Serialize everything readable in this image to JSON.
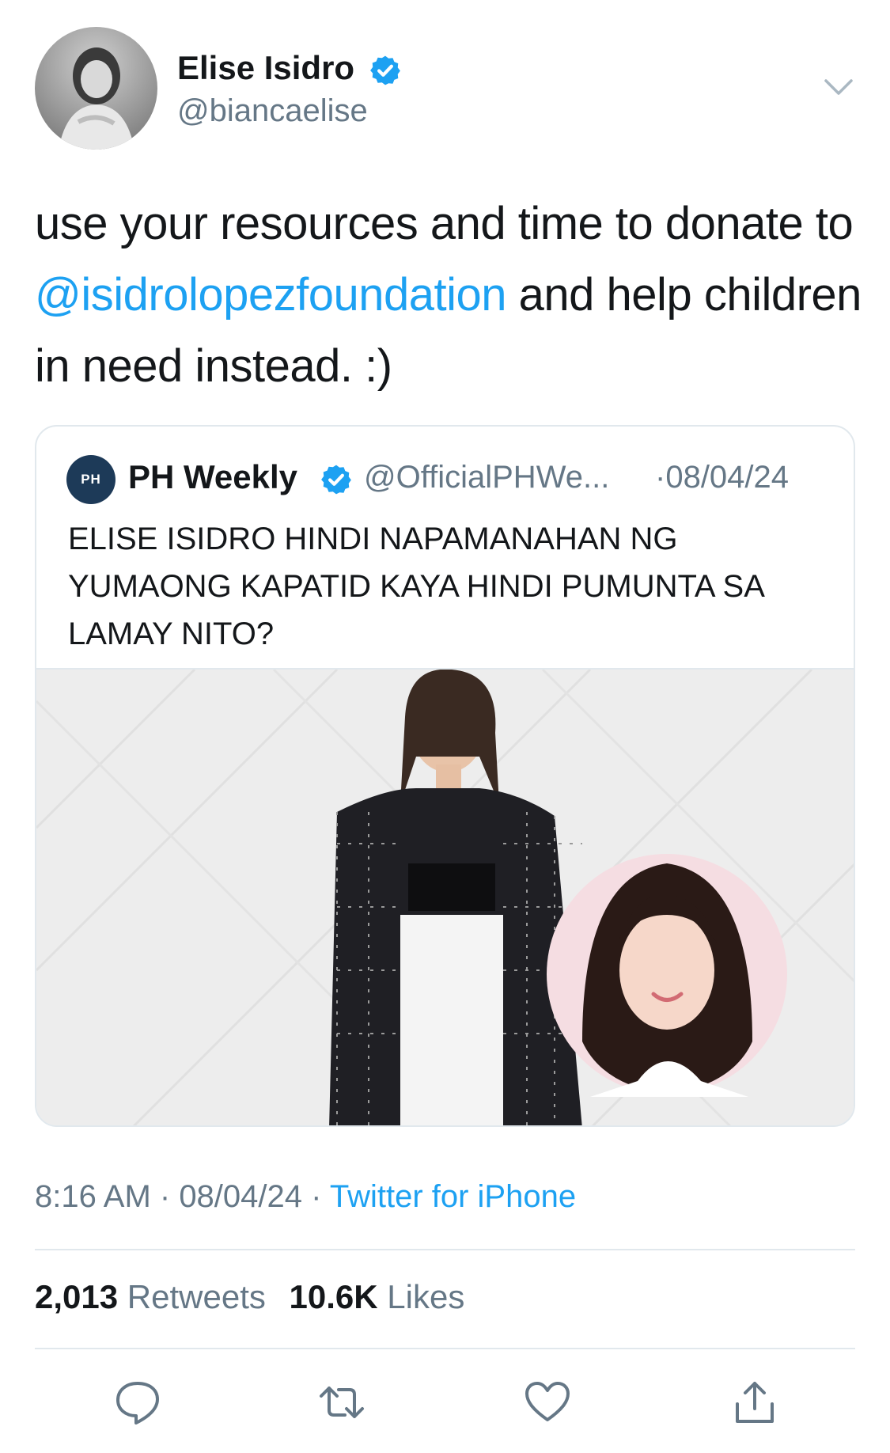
{
  "tweet": {
    "author": {
      "name": "Elise Isidro",
      "handle": "@biancaelise",
      "verified_icon": "verified-badge-icon",
      "avatar": "avatar"
    },
    "menu_icon": "chevron-down-icon",
    "text": {
      "before_mention": "use your resources and time to donate to ",
      "mention": "@isidrolopezfoundation",
      "after_mention": " and help children in need instead. :)"
    },
    "quoted": {
      "author_name": "PH Weekly",
      "author_handle": "@OfficialPHWe...",
      "date": "·08/04/24",
      "avatar_label": "PH",
      "text": "ELISE ISIDRO HINDI NAPAMANAHAN NG YUMAONG KAPATID KAYA HINDI PUMUNTA SA LAMAY NITO?",
      "media": "photo"
    },
    "meta": {
      "time": "8:16 AM",
      "sep1": " · ",
      "date": "08/04/24",
      "sep2": " · ",
      "source": "Twitter for iPhone"
    },
    "stats": {
      "retweets_count": "2,013",
      "retweets_label": "Retweets",
      "likes_count": "10.6K",
      "likes_label": "Likes"
    },
    "actions": [
      "reply-icon",
      "retweet-icon",
      "like-icon",
      "share-icon"
    ]
  },
  "colors": {
    "link": "#1da1f2",
    "secondary_text": "#657786",
    "primary_text": "#14171a",
    "border": "#e1e8ed",
    "verified": "#1da1f2"
  }
}
